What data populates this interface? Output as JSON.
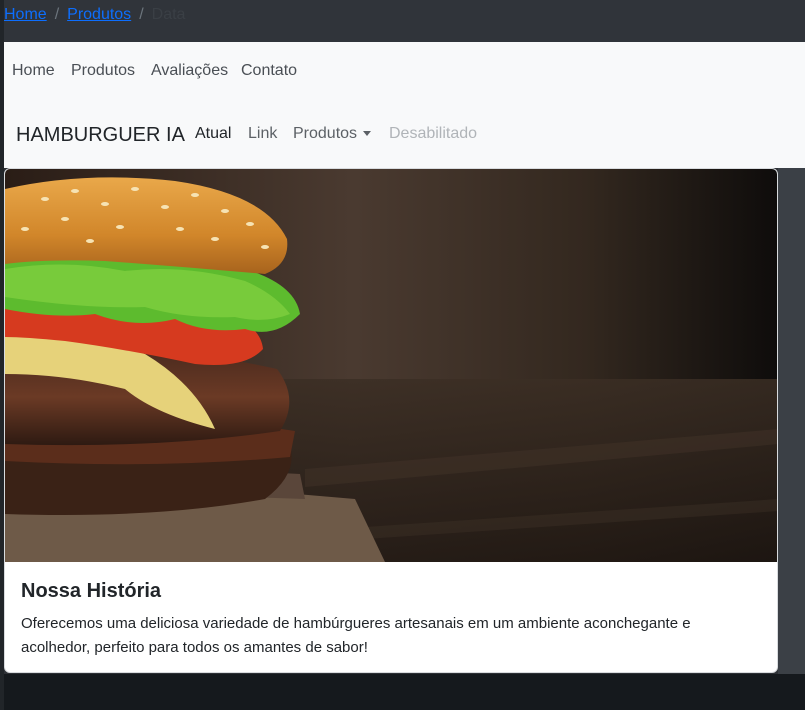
{
  "breadcrumb": {
    "items": [
      "Home",
      "Produtos"
    ],
    "current": "Data"
  },
  "topnav": {
    "items": [
      "Home",
      "Produtos",
      "Avaliações",
      "Contato"
    ]
  },
  "navbar": {
    "brand": "HAMBURGUER IA",
    "links": {
      "active": "Atual",
      "link": "Link",
      "dropdown": "Produtos",
      "disabled": "Desabilitado"
    }
  },
  "card": {
    "title": "Nossa História",
    "text": "Oferecemos uma deliciosa variedade de hambúrgueres artesanais em um ambiente aconchegante e acolhedor, perfeito para todos os amantes de sabor!"
  },
  "colors": {
    "link": "#0d6efd",
    "navbar_bg": "#f8f9fa",
    "page_bg": "#212529"
  }
}
